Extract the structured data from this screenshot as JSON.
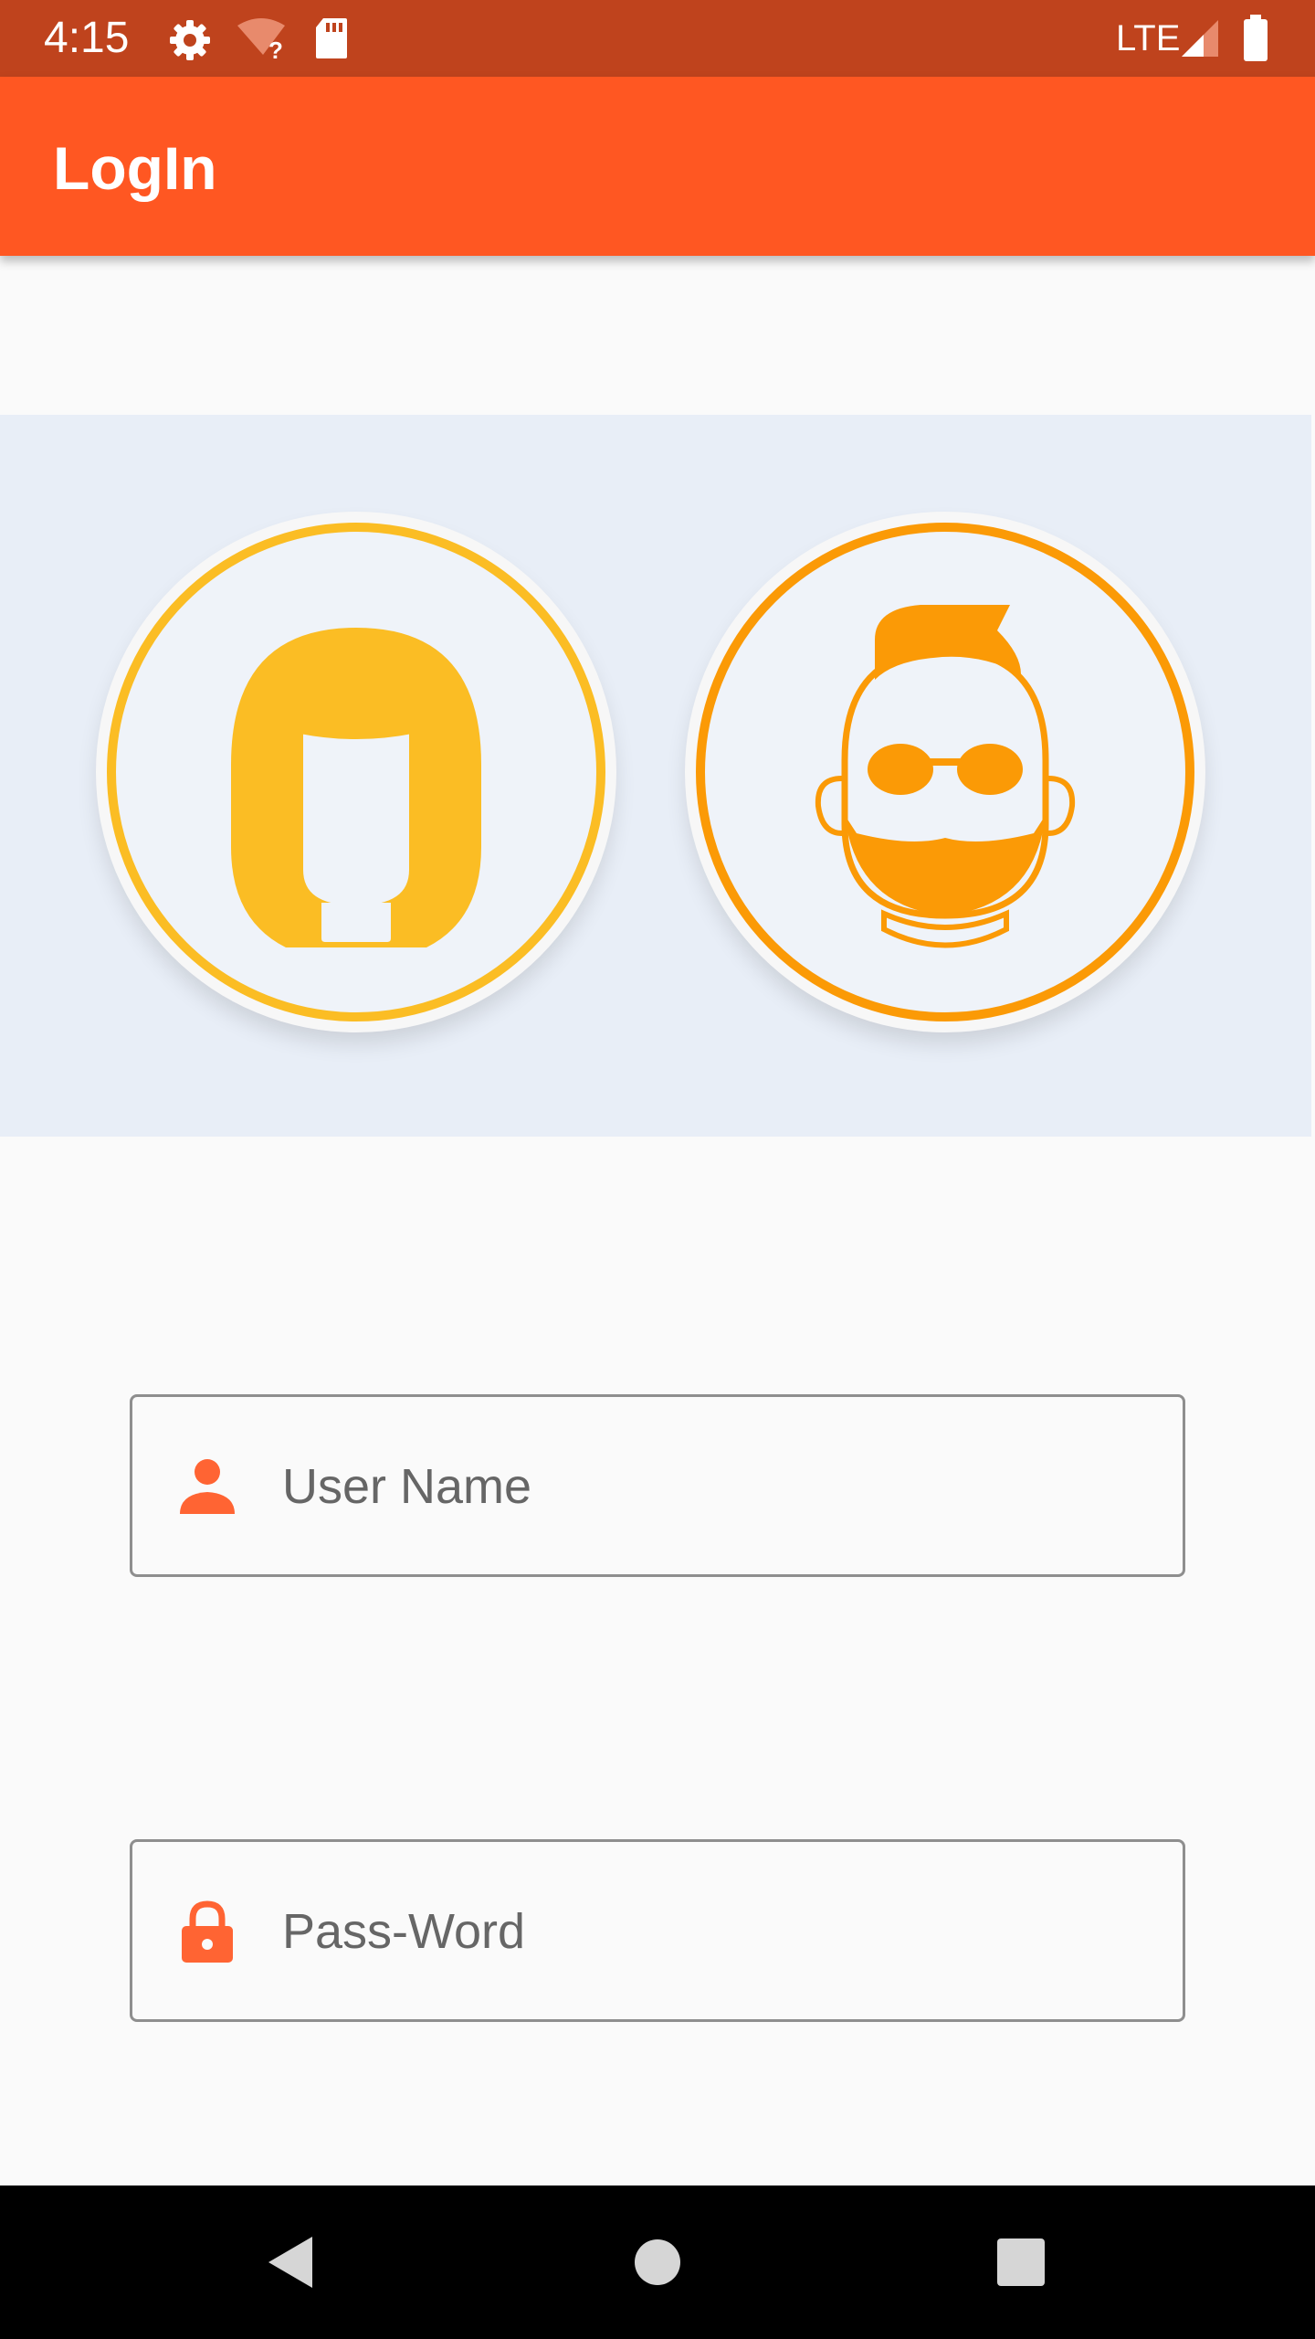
{
  "status_bar": {
    "time": "4:15",
    "network": "LTE",
    "icons": [
      "settings-icon",
      "wifi-unknown-icon",
      "sd-card-icon",
      "signal-icon",
      "battery-icon"
    ]
  },
  "app_bar": {
    "title": "LogIn"
  },
  "avatars": [
    {
      "name": "female-avatar",
      "ring_color": "#fbbd24"
    },
    {
      "name": "male-avatar",
      "ring_color": "#fb9a06"
    }
  ],
  "form": {
    "username": {
      "placeholder": "User Name",
      "value": "",
      "icon": "person-icon"
    },
    "password": {
      "placeholder": "Pass-Word",
      "value": "",
      "icon": "lock-icon"
    }
  },
  "navigation": {
    "buttons": [
      "back-icon",
      "home-icon",
      "recents-icon"
    ]
  },
  "colors": {
    "status_bar": "#bf431d",
    "app_bar": "#ff5722",
    "accent": "#ff6433",
    "female_avatar": "#fbbd24",
    "male_avatar": "#fb9a06",
    "band": "#e8eef7"
  }
}
